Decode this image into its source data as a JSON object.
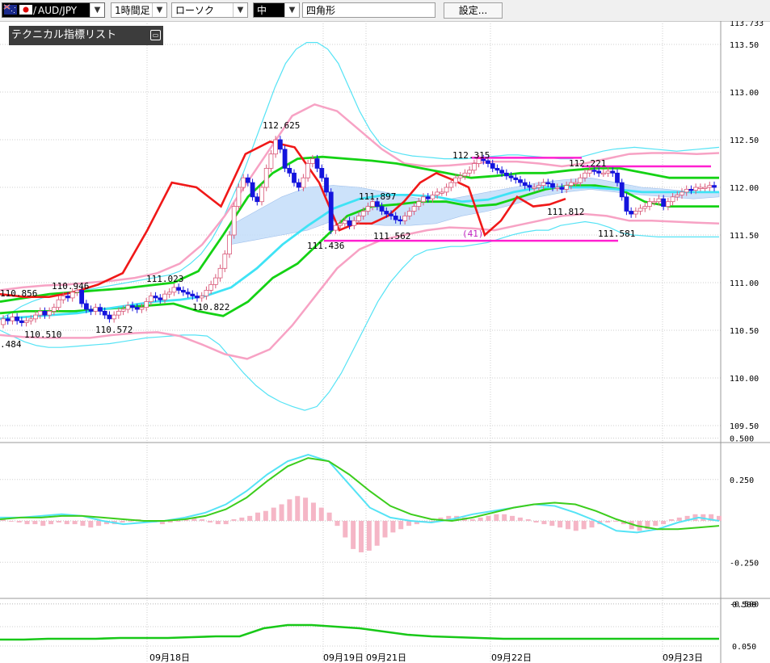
{
  "toolbar": {
    "symbol": "AUD/JPY",
    "period": "1時間足",
    "chart_type": "ローソク",
    "color_label": "中",
    "shape": "四角形",
    "settings": "設定..."
  },
  "legend": {
    "title": "テクニカル指標リスト"
  },
  "colors": {
    "bb_outer": "#55e3f5",
    "bb_inner": "#f7a2c4",
    "ma_mid": "#3fe3f5",
    "green": "#14d214",
    "red": "#f01818",
    "magenta": "#ff20d0",
    "cloud": "#c4defa",
    "bull": "#f7a9be",
    "bear": "#1414dd",
    "macd": "#55e3f5",
    "signal": "#3ccd1c",
    "hist": "#f5b6c6"
  },
  "chart_data": {
    "type": "candlestick",
    "symbol": "AUD/JPY",
    "timeframe": "1時間足",
    "x_labels": [
      "09月18日",
      "09月19日",
      "09月21日",
      "09月22日",
      "09月23日"
    ],
    "price_axis": {
      "ylim": [
        109.5,
        113.733
      ],
      "ticks": [
        "113.50",
        "113.00",
        "112.50",
        "112.00",
        "111.50",
        "111.00",
        "110.50",
        "110.00",
        "109.50"
      ],
      "top_label": "113.733"
    },
    "annotations": [
      {
        "label": "110.856",
        "x": 0,
        "y": 110.856
      },
      {
        "label": "110.946",
        "x": 16,
        "y": 110.946
      },
      {
        "label": "110.510",
        "x": 9,
        "y": 110.51
      },
      {
        "label": ".484",
        "x": 0,
        "y": 110.484
      },
      {
        "label": "110.572",
        "x": 24,
        "y": 110.572
      },
      {
        "label": "111.023",
        "x": 36,
        "y": 111.023
      },
      {
        "label": "110.822",
        "x": 45,
        "y": 110.822
      },
      {
        "label": "112.625",
        "x": 62,
        "y": 112.625
      },
      {
        "label": "111.436",
        "x": 72,
        "y": 111.436
      },
      {
        "label": "111.897",
        "x": 82,
        "y": 111.897
      },
      {
        "label": "111.562",
        "x": 86,
        "y": 111.562
      },
      {
        "label": "112.315",
        "x": 105,
        "y": 112.315
      },
      {
        "label": "(41)",
        "x": 105,
        "y": 111.56
      },
      {
        "label": "111.812",
        "x": 126,
        "y": 111.812
      },
      {
        "label": "112.221",
        "x": 130,
        "y": 112.221
      },
      {
        "label": "111.581",
        "x": 136,
        "y": 111.581
      }
    ],
    "candles_o": [
      110.56,
      110.62,
      110.6,
      110.64,
      110.6,
      110.58,
      110.6,
      110.62,
      110.66,
      110.7,
      110.66,
      110.7,
      110.74,
      110.82,
      110.86,
      110.84,
      110.9,
      110.92,
      110.78,
      110.72,
      110.7,
      110.74,
      110.7,
      110.66,
      110.62,
      110.66,
      110.7,
      110.72,
      110.76,
      110.74,
      110.72,
      110.74,
      110.8,
      110.86,
      110.84,
      110.82,
      110.88,
      110.9,
      110.95,
      110.92,
      110.9,
      110.88,
      110.86,
      110.84,
      110.86,
      110.92,
      110.98,
      111.05,
      111.15,
      111.3,
      111.5,
      111.8,
      112.0,
      112.1,
      112.05,
      111.9,
      111.85,
      112.0,
      112.2,
      112.35,
      112.5,
      112.4,
      112.2,
      112.15,
      112.05,
      112.0,
      112.1,
      112.25,
      112.3,
      112.2,
      112.1,
      111.95,
      111.55,
      111.6,
      111.62,
      111.65,
      111.6,
      111.65,
      111.7,
      111.75,
      111.8,
      111.85,
      111.8,
      111.75,
      111.72,
      111.7,
      111.66,
      111.65,
      111.7,
      111.75,
      111.8,
      111.85,
      111.9,
      111.88,
      111.92,
      111.95,
      111.95,
      112.0,
      112.05,
      112.1,
      112.12,
      112.15,
      112.18,
      112.25,
      112.3,
      112.28,
      112.25,
      112.2,
      112.18,
      112.15,
      112.12,
      112.1,
      112.08,
      112.05,
      112.02,
      112.0,
      112.0,
      112.02,
      112.05,
      112.04,
      112.0,
      112.0,
      111.98,
      112.02,
      112.05,
      112.05,
      112.1,
      112.15,
      112.18,
      112.17,
      112.15,
      112.15,
      112.17,
      112.15,
      112.05,
      111.9,
      111.75,
      111.72,
      111.75,
      111.78,
      111.8,
      111.85,
      111.85,
      111.88,
      111.8,
      111.85,
      111.9,
      111.92,
      111.95,
      111.98,
      111.97,
      112.0,
      112.0,
      112.0,
      112.02
    ],
    "candles_c": [
      110.62,
      110.6,
      110.64,
      110.6,
      110.58,
      110.6,
      110.62,
      110.66,
      110.7,
      110.66,
      110.7,
      110.74,
      110.82,
      110.86,
      110.84,
      110.9,
      110.92,
      110.78,
      110.72,
      110.7,
      110.74,
      110.7,
      110.66,
      110.62,
      110.66,
      110.7,
      110.72,
      110.76,
      110.74,
      110.72,
      110.74,
      110.8,
      110.86,
      110.84,
      110.82,
      110.88,
      110.9,
      110.95,
      110.92,
      110.9,
      110.88,
      110.86,
      110.84,
      110.86,
      110.92,
      110.98,
      111.05,
      111.15,
      111.3,
      111.5,
      111.8,
      112.0,
      112.1,
      112.05,
      111.9,
      111.85,
      112.0,
      112.2,
      112.35,
      112.5,
      112.4,
      112.2,
      112.15,
      112.05,
      112.0,
      112.1,
      112.25,
      112.3,
      112.2,
      112.1,
      111.95,
      111.55,
      111.6,
      111.62,
      111.65,
      111.6,
      111.65,
      111.7,
      111.75,
      111.8,
      111.85,
      111.8,
      111.75,
      111.72,
      111.7,
      111.66,
      111.65,
      111.7,
      111.75,
      111.8,
      111.85,
      111.9,
      111.88,
      111.92,
      111.95,
      111.95,
      112.0,
      112.05,
      112.1,
      112.12,
      112.15,
      112.18,
      112.25,
      112.3,
      112.28,
      112.25,
      112.2,
      112.18,
      112.15,
      112.12,
      112.1,
      112.08,
      112.05,
      112.02,
      112.0,
      112.0,
      112.02,
      112.05,
      112.04,
      112.0,
      112.0,
      111.98,
      112.02,
      112.05,
      112.05,
      112.1,
      112.15,
      112.18,
      112.17,
      112.15,
      112.15,
      112.17,
      112.15,
      112.05,
      111.9,
      111.75,
      111.72,
      111.75,
      111.78,
      111.8,
      111.85,
      111.85,
      111.88,
      111.8,
      111.85,
      111.9,
      111.92,
      111.95,
      111.98,
      111.97,
      112.0,
      112.0,
      112.0,
      112.02,
      112.0
    ],
    "bb_upper2_y": [
      110.62,
      110.68,
      110.75,
      110.8,
      110.84,
      110.86,
      110.88,
      110.9,
      110.92,
      110.94,
      110.96,
      110.98,
      111.0,
      111.02,
      111.04,
      111.06,
      111.08,
      111.12,
      111.2,
      111.3,
      111.45,
      111.65,
      111.9,
      112.15,
      112.45,
      112.75,
      113.05,
      113.3,
      113.45,
      113.52,
      113.52,
      113.45,
      113.3,
      113.05,
      112.8,
      112.6,
      112.45,
      112.38,
      112.35,
      112.33,
      112.32,
      112.31,
      112.3,
      112.3,
      112.3,
      112.31,
      112.32,
      112.33,
      112.34,
      112.34,
      112.33,
      112.32,
      112.31,
      112.3,
      112.3,
      112.32,
      112.35,
      112.38,
      112.4,
      112.41,
      112.42,
      112.41,
      112.4,
      112.39,
      112.38,
      112.39,
      112.4,
      112.41,
      112.42
    ],
    "bb_lower2_y": [
      110.5,
      110.44,
      110.38,
      110.34,
      110.32,
      110.32,
      110.33,
      110.34,
      110.35,
      110.36,
      110.38,
      110.4,
      110.42,
      110.43,
      110.44,
      110.45,
      110.45,
      110.44,
      110.35,
      110.2,
      110.05,
      109.92,
      109.82,
      109.75,
      109.7,
      109.66,
      109.7,
      109.85,
      110.05,
      110.3,
      110.55,
      110.8,
      111.0,
      111.15,
      111.28,
      111.34,
      111.36,
      111.38,
      111.38,
      111.4,
      111.42,
      111.46,
      111.5,
      111.53,
      111.55,
      111.55,
      111.6,
      111.62,
      111.64,
      111.62,
      111.58,
      111.52,
      111.5,
      111.49,
      111.48,
      111.48,
      111.48,
      111.48,
      111.48,
      111.48
    ],
    "macd": {
      "ticks": [
        "0.500",
        "0.250",
        "-0.250",
        "-0.500"
      ],
      "ylim": [
        -0.55,
        0.55
      ]
    },
    "lower": {
      "ticks": [
        "0.500",
        "0.050"
      ]
    }
  }
}
